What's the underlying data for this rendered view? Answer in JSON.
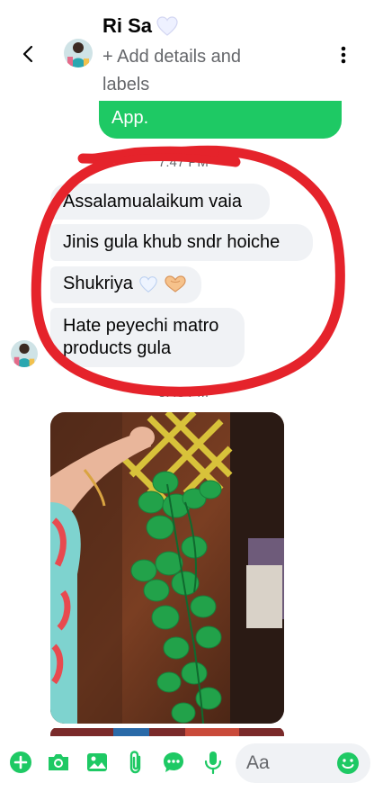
{
  "header": {
    "name": "Ri Sa",
    "details_text": "+ Add details and labels"
  },
  "messages": {
    "green_bubble_text": "App.",
    "time_1": "7:47 PM",
    "time_2": "8:48 PM",
    "incoming": [
      "Assalamualaikum vaia",
      "Jinis gula khub sndr hoiche",
      "Shukriya",
      "Hate peyechi matro products gula"
    ]
  },
  "composer": {
    "placeholder": "Aa"
  },
  "icons": [
    "back-icon",
    "avatar",
    "more-icon",
    "add-icon",
    "camera-icon",
    "gallery-icon",
    "attach-icon",
    "chat-icon",
    "mic-icon",
    "emoji-icon",
    "white-heart-icon",
    "heart-hands-icon"
  ],
  "colors": {
    "accent": "#1ec964",
    "bubble_gray": "#f0f2f5",
    "annotation_red": "#e5232b",
    "text_secondary": "#65676b"
  }
}
